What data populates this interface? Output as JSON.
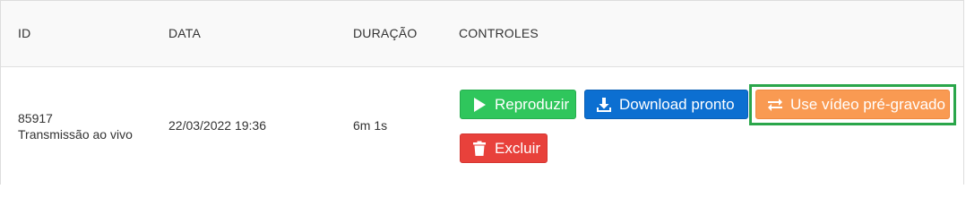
{
  "table": {
    "headers": {
      "id": "ID",
      "date": "DATA",
      "duration": "DURAÇÃO",
      "controls": "CONTROLES"
    },
    "rows": [
      {
        "id": "85917",
        "type": "Transmissão ao vivo",
        "date": "22/03/2022 19:36",
        "duration": "6m 1s",
        "buttons": {
          "play": "Reproduzir",
          "download": "Download pronto",
          "prerecorded": "Use vídeo pré-gravado",
          "delete": "Excluir"
        }
      }
    ]
  },
  "colors": {
    "play": "#2fc65c",
    "download": "#0c6fd1",
    "prerecorded": "#f99a52",
    "delete": "#e8413b",
    "highlight": "#2aa64a"
  },
  "icons": {
    "play": "play-icon",
    "download": "download-icon",
    "prerecorded": "swap-arrows-icon",
    "delete": "trash-icon"
  }
}
